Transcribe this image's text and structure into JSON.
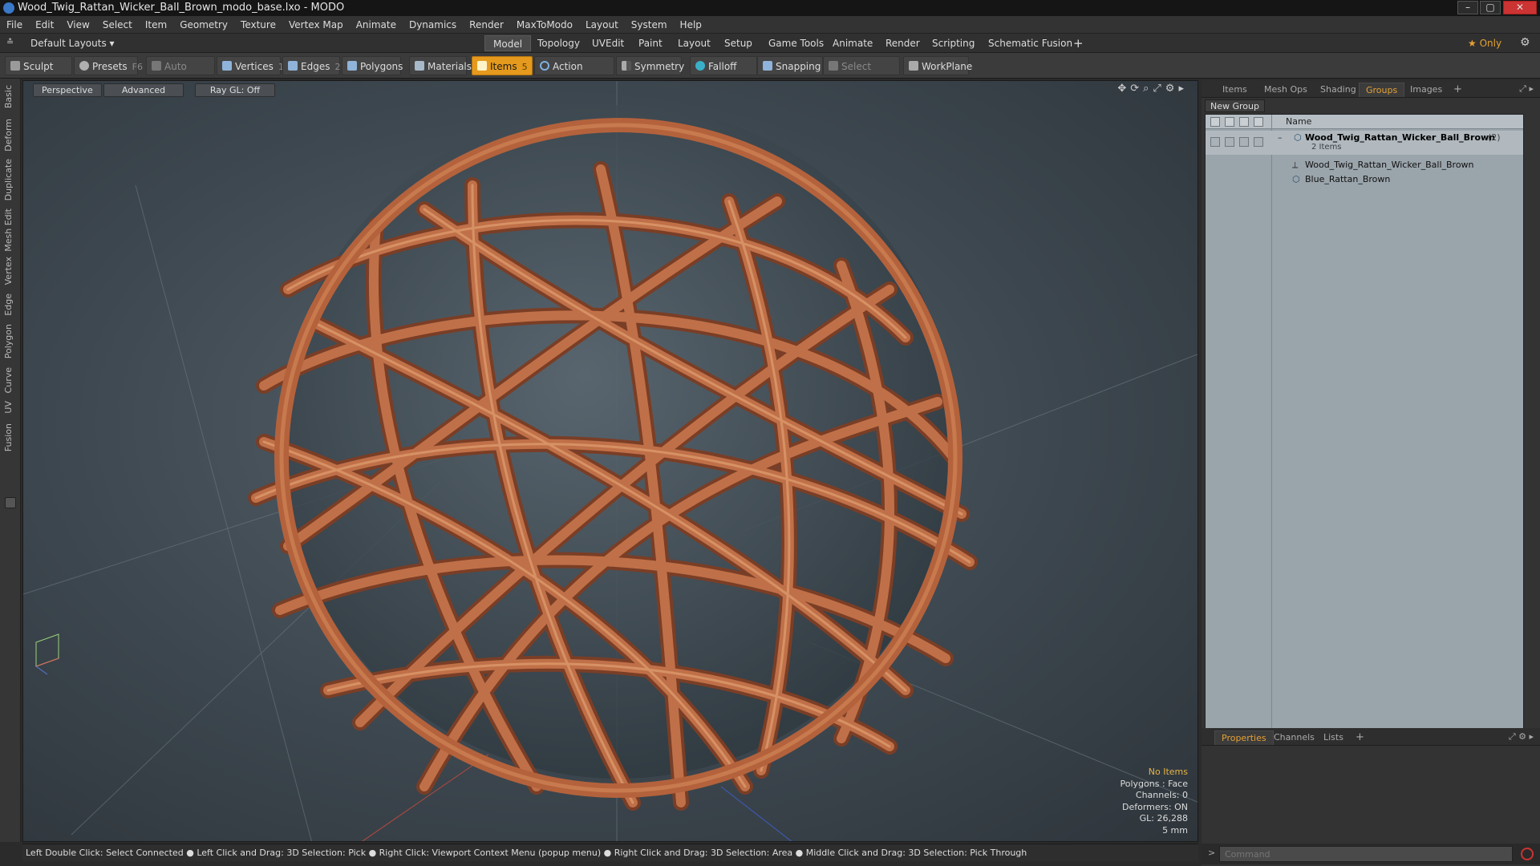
{
  "window": {
    "title": "Wood_Twig_Rattan_Wicker_Ball_Brown_modo_base.lxo - MODO",
    "min": "–",
    "max": "▢",
    "close": "✕"
  },
  "menu": [
    "File",
    "Edit",
    "View",
    "Select",
    "Item",
    "Geometry",
    "Texture",
    "Vertex Map",
    "Animate",
    "Dynamics",
    "Render",
    "MaxToModo",
    "Layout",
    "System",
    "Help"
  ],
  "layoutbar": {
    "preset": "Default Layouts ▾",
    "tabs": [
      "Model",
      "Topology",
      "UVEdit",
      "Paint",
      "Layout",
      "Setup",
      "Game Tools",
      "Animate",
      "Render",
      "Scripting",
      "Schematic Fusion"
    ],
    "active_tab": "Model",
    "add": "+",
    "only": "★ Only"
  },
  "toolbar": {
    "sculpt": "Sculpt",
    "presets": "Presets",
    "presets_key": "F6",
    "auto_select": "Auto Select",
    "vertices": "Vertices",
    "vertices_key": "1",
    "edges": "Edges",
    "edges_key": "2",
    "polygons": "Polygons",
    "materials": "Materials",
    "items": "Items",
    "items_key": "5",
    "action_center": "Action Center",
    "symmetry": "Symmetry",
    "falloff": "Falloff",
    "snapping": "Snapping",
    "select_through": "Select Through",
    "workplane": "WorkPlane"
  },
  "lefttabs": [
    "Basic",
    "Deform",
    "Duplicate",
    "Mesh Edit",
    "Vertex",
    "Edge",
    "Polygon",
    "Curve",
    "UV",
    "Fusion"
  ],
  "viewport": {
    "perspective": "Perspective",
    "advanced": "Advanced",
    "raygl": "Ray GL: Off",
    "hud": {
      "items": "No Items",
      "polygons": "Polygons : Face",
      "channels": "Channels: 0",
      "deformers": "Deformers: ON",
      "gl": "GL: 26,288",
      "units": "5 mm"
    }
  },
  "statusbar": "Left Double Click: Select Connected ● Left Click and Drag: 3D Selection: Pick ● Right Click: Viewport Context Menu (popup menu) ● Right Click and Drag: 3D Selection: Area ● Middle Click and Drag: 3D Selection: Pick Through",
  "panel_top": {
    "tabs": [
      "Items",
      "Mesh Ops",
      "Shading",
      "Groups",
      "Images"
    ],
    "active_tab": "Groups",
    "add": "+",
    "new_group": "New Group",
    "col_name": "Name",
    "group_name": "Wood_Twig_Rattan_Wicker_Ball_Brown",
    "group_count": "(2)",
    "group_sub": "2 Items",
    "children": [
      "Wood_Twig_Rattan_Wicker_Ball_Brown",
      "Blue_Rattan_Brown"
    ]
  },
  "panel_bottom": {
    "tabs": [
      "Properties",
      "Channels",
      "Lists"
    ],
    "active_tab": "Properties",
    "add": "+"
  },
  "command": {
    "placeholder": "Command"
  },
  "colors": {
    "accent": "#e59a1d",
    "wicker": "#b8673f",
    "viewport_bg": "#3d474f"
  }
}
